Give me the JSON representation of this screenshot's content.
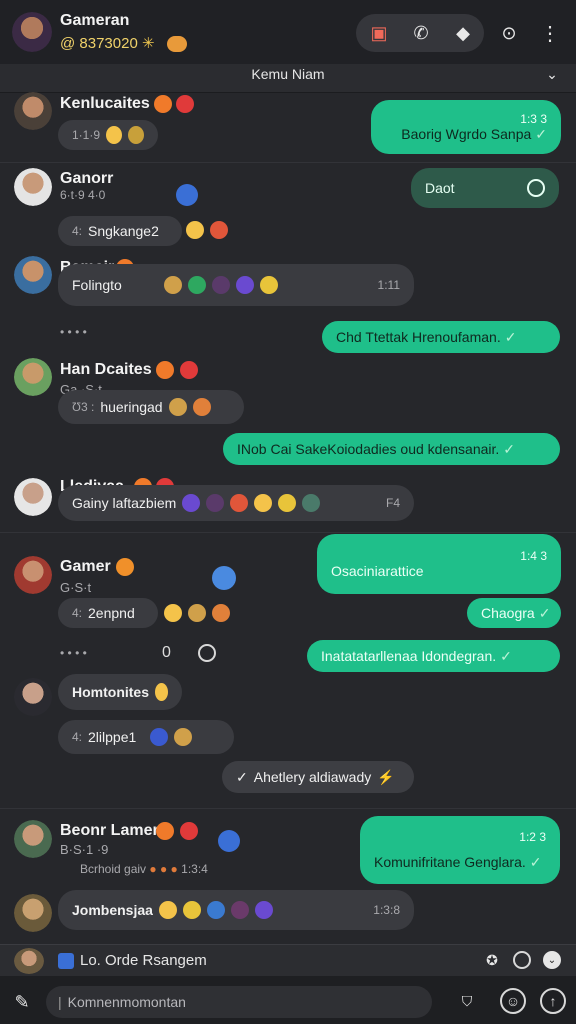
{
  "header": {
    "name": "Gameran",
    "sub": "@ 8373020",
    "chat_title": "Kemu Niam"
  },
  "messages": {
    "m1_name": "Kenlucaites",
    "m1_meta": "1·1·9",
    "m1_out": "Baorig Wgrdo Sanpa",
    "m1_out_time": "1:3 3",
    "m2_name": "Ganorr",
    "m2_meta": "6·t·9  4·0",
    "m2_reply": "Sngkange2",
    "m2_out": "Daot",
    "m3_name": "Bamcir",
    "m3_text": "Folingto",
    "m3_time": "1:11",
    "m4_out": "Chd Ttettak Hrenoufaman.",
    "m5_name": "Han Dcaites",
    "m5_meta": "Ga ·S·t",
    "m5_reply": "hueringad",
    "m6_out": "INob Cai SakeKoiodadies oud kdensanair.",
    "m7_name": "Lledivaa",
    "m7_text": "Gainy laftazbiem",
    "m7_time": "F4",
    "m8_name": "Gamer",
    "m8_meta": "G·S·t",
    "m8_out": "Osaciniarattice",
    "m8_out_time": "1:4 3",
    "m8_reply": "2enpnd",
    "m9_out": "Chaogra",
    "m10_out": "Inatatatarllenaa Idondegran.",
    "m11_name": "Homtonites",
    "m11_reply": "2lilppe1",
    "system": "Ahetlery aldiawady",
    "m12_name": "Beonr Lamer",
    "m12_meta": "B·S·1 ·9",
    "m12_sub": "Bcrhoid gaiv",
    "m12_sub_time": "1:3:4",
    "m12_out": "Komunifritane Genglara.",
    "m12_out_time": "1:2 3",
    "m13_name": "Jombensjaa",
    "m13_time": "1:3:8"
  },
  "footer": {
    "reply_label": "Lo. Orde Rsangem",
    "composer_placeholder": "Komnenmomontan"
  },
  "colors": {
    "accent": "#1fbf8a",
    "background": "#26272b",
    "bubble_in": "#3a3b40"
  }
}
